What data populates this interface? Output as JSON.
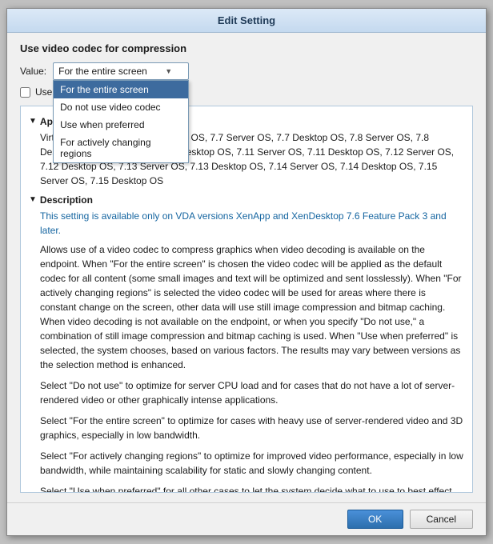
{
  "dialog": {
    "title": "Edit Setting",
    "section_title": "Use video codec for compression",
    "value_label": "Value:",
    "dropdown": {
      "selected": "For the entire screen",
      "options": [
        "For the entire screen",
        "Do not use video codec",
        "Use when preferred",
        "For actively changing regions"
      ]
    },
    "use_checkbox_label": "Use",
    "applies_header": "Applies",
    "applies_text": "Virtual Delivery Agent: 7.6 Desktop OS, 7.7 Server OS, 7.7 Desktop OS, 7.8 Server OS, 7.8 Desktop OS, 7.9 Server OS, 7.9 Desktop OS, 7.11 Server OS, 7.11 Desktop OS, 7.12 Server OS, 7.12 Desktop OS, 7.13 Server OS, 7.13 Desktop OS, 7.14 Server OS, 7.14 Desktop OS, 7.15 Server OS, 7.15 Desktop OS",
    "description_header": "Description",
    "desc_intro": "This setting is available only on VDA versions XenApp and XenDesktop 7.6 Feature Pack 3 and later.",
    "desc_para1": "Allows use of a video codec to compress graphics when video decoding is available on the endpoint. When \"For the entire screen\" is chosen the video codec will be applied as the default codec for all content (some small images and text will be optimized and sent losslessly). When \"For actively changing regions\" is selected the video codec will be used for areas where there is constant change on the screen, other data will use still image compression and bitmap caching. When video decoding is not available on the endpoint, or when you specify \"Do not use,\" a combination of still image compression and bitmap caching is used. When \"Use when preferred\" is selected, the system chooses, based on various factors. The results may vary between versions as the selection method is enhanced.",
    "desc_para2": "Select \"Do not use\" to optimize for server CPU load and for cases that do not have a lot of server-rendered video or other graphically intense applications.",
    "desc_para3": "Select \"For the entire screen\" to optimize for cases with heavy use of server-rendered video and 3D graphics, especially in low bandwidth.",
    "desc_para4": "Select \"For actively changing regions\" to optimize for improved video performance, especially in low bandwidth, while maintaining scalability for static and slowly changing content.",
    "desc_para5": "Select \"Use when preferred\" for all other cases to let the system decide what to use to best effect.",
    "ok_label": "OK",
    "cancel_label": "Cancel"
  }
}
